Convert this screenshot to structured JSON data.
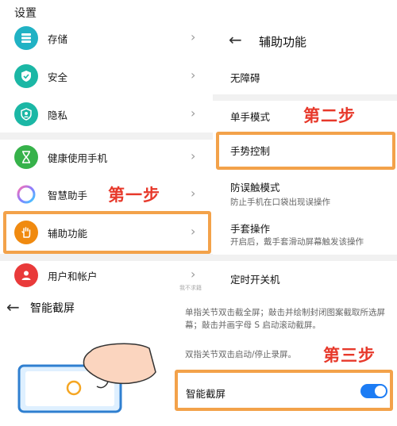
{
  "settings": {
    "title": "设置",
    "items": [
      {
        "label": "存储",
        "icon": "storage-icon",
        "color": "#20b2c4"
      },
      {
        "label": "安全",
        "icon": "shield-check-icon",
        "color": "#1bb7a5"
      },
      {
        "label": "隐私",
        "icon": "privacy-icon",
        "color": "#1bb7a5"
      },
      {
        "label": "健康使用手机",
        "icon": "hourglass-icon",
        "color": "#36b24a"
      },
      {
        "label": "智慧助手",
        "icon": "assistant-ring-icon",
        "color": "#a07cf0"
      },
      {
        "label": "辅助功能",
        "icon": "hand-icon",
        "color": "#f08a10"
      },
      {
        "label": "用户和帐户",
        "icon": "user-icon",
        "color": "#e93a3a"
      }
    ],
    "chevron": "›"
  },
  "accessibility": {
    "back": "←",
    "title": "辅助功能",
    "items": [
      {
        "label": "无障碍"
      },
      {
        "label": "单手模式"
      },
      {
        "label": "手势控制"
      },
      {
        "label": "防误触模式",
        "sub": "防止手机在口袋出现误操作"
      },
      {
        "label": "手套操作",
        "sub": "开启后，戴手套滑动屏幕触发该操作"
      },
      {
        "label": "定时开关机"
      }
    ]
  },
  "steps": {
    "step1": "第一步",
    "step2": "第二步",
    "step3": "第三步"
  },
  "smart_screenshot": {
    "back": "←",
    "title": "智能截屏",
    "desc1": "单指关节双击截全屏；敲击并绘制封闭图案截取所选屏幕；敲击并画字母 S 启动滚动截屏。",
    "desc2": "双指关节双击启动/停止录屏。",
    "toggle_label": "智能截屏",
    "toggle_on": true
  },
  "watermark": "我不求籍",
  "accent": "#f3a24a",
  "step_color": "#e7392b",
  "toggle_color": "#1c7cf4"
}
